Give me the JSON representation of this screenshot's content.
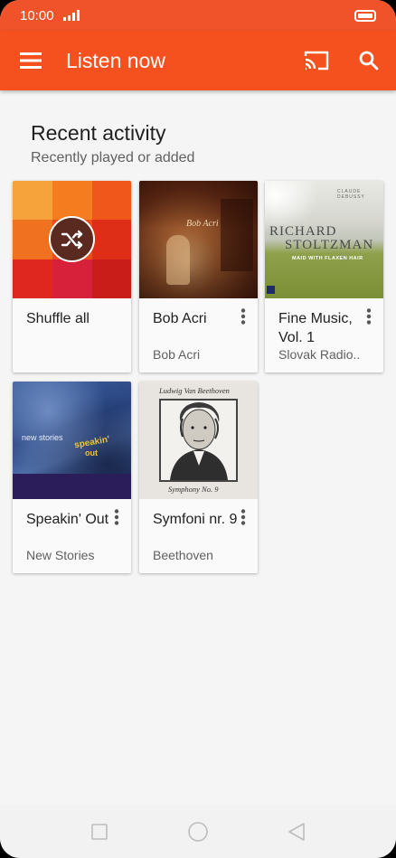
{
  "status_bar": {
    "time": "10:00"
  },
  "app_bar": {
    "title": "Listen now"
  },
  "section": {
    "title": "Recent activity",
    "subtitle": "Recently played or added"
  },
  "cards": [
    {
      "title": "Shuffle all",
      "subtitle": ""
    },
    {
      "title": "Bob Acri",
      "subtitle": "Bob Acri",
      "art_text": "Bob Acri"
    },
    {
      "title": "Fine Music, Vol. 1",
      "subtitle": "Slovak Radio..",
      "art_top": "CLAUDE DEBUSSY",
      "art_name1": "RICHARD",
      "art_name2": "STOLTZMAN",
      "art_sub": "MAID WITH FLAXEN HAIR"
    },
    {
      "title": "Speakin' Out",
      "subtitle": "New Stories",
      "art_line1": "new stories",
      "art_line2": "speakin'",
      "art_line3": "out"
    },
    {
      "title": "Symfoni nr. 9",
      "subtitle": "Beethoven",
      "art_top": "Ludwig Van Beethoven",
      "art_bottom": "Symphony No. 9"
    }
  ],
  "colors": {
    "accent": "#f4511e",
    "status_bar": "#f0522a",
    "background": "#f5f5f5"
  },
  "icons": [
    "signal-icon",
    "battery-icon",
    "menu-icon",
    "cast-icon",
    "search-icon",
    "shuffle-icon",
    "more-vert-icon",
    "nav-recents-icon",
    "nav-home-icon",
    "nav-back-icon"
  ]
}
